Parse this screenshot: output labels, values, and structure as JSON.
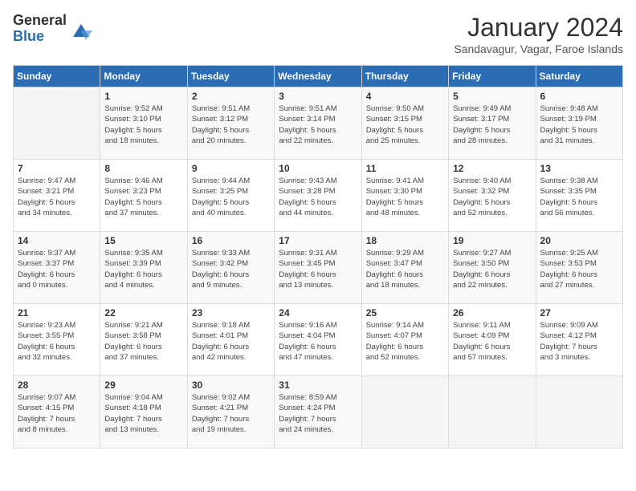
{
  "logo": {
    "general": "General",
    "blue": "Blue"
  },
  "header": {
    "title": "January 2024",
    "location": "Sandavagur, Vagar, Faroe Islands"
  },
  "weekdays": [
    "Sunday",
    "Monday",
    "Tuesday",
    "Wednesday",
    "Thursday",
    "Friday",
    "Saturday"
  ],
  "weeks": [
    [
      {
        "day": "",
        "info": ""
      },
      {
        "day": "1",
        "info": "Sunrise: 9:52 AM\nSunset: 3:10 PM\nDaylight: 5 hours\nand 18 minutes."
      },
      {
        "day": "2",
        "info": "Sunrise: 9:51 AM\nSunset: 3:12 PM\nDaylight: 5 hours\nand 20 minutes."
      },
      {
        "day": "3",
        "info": "Sunrise: 9:51 AM\nSunset: 3:14 PM\nDaylight: 5 hours\nand 22 minutes."
      },
      {
        "day": "4",
        "info": "Sunrise: 9:50 AM\nSunset: 3:15 PM\nDaylight: 5 hours\nand 25 minutes."
      },
      {
        "day": "5",
        "info": "Sunrise: 9:49 AM\nSunset: 3:17 PM\nDaylight: 5 hours\nand 28 minutes."
      },
      {
        "day": "6",
        "info": "Sunrise: 9:48 AM\nSunset: 3:19 PM\nDaylight: 5 hours\nand 31 minutes."
      }
    ],
    [
      {
        "day": "7",
        "info": "Sunrise: 9:47 AM\nSunset: 3:21 PM\nDaylight: 5 hours\nand 34 minutes."
      },
      {
        "day": "8",
        "info": "Sunrise: 9:46 AM\nSunset: 3:23 PM\nDaylight: 5 hours\nand 37 minutes."
      },
      {
        "day": "9",
        "info": "Sunrise: 9:44 AM\nSunset: 3:25 PM\nDaylight: 5 hours\nand 40 minutes."
      },
      {
        "day": "10",
        "info": "Sunrise: 9:43 AM\nSunset: 3:28 PM\nDaylight: 5 hours\nand 44 minutes."
      },
      {
        "day": "11",
        "info": "Sunrise: 9:41 AM\nSunset: 3:30 PM\nDaylight: 5 hours\nand 48 minutes."
      },
      {
        "day": "12",
        "info": "Sunrise: 9:40 AM\nSunset: 3:32 PM\nDaylight: 5 hours\nand 52 minutes."
      },
      {
        "day": "13",
        "info": "Sunrise: 9:38 AM\nSunset: 3:35 PM\nDaylight: 5 hours\nand 56 minutes."
      }
    ],
    [
      {
        "day": "14",
        "info": "Sunrise: 9:37 AM\nSunset: 3:37 PM\nDaylight: 6 hours\nand 0 minutes."
      },
      {
        "day": "15",
        "info": "Sunrise: 9:35 AM\nSunset: 3:39 PM\nDaylight: 6 hours\nand 4 minutes."
      },
      {
        "day": "16",
        "info": "Sunrise: 9:33 AM\nSunset: 3:42 PM\nDaylight: 6 hours\nand 9 minutes."
      },
      {
        "day": "17",
        "info": "Sunrise: 9:31 AM\nSunset: 3:45 PM\nDaylight: 6 hours\nand 13 minutes."
      },
      {
        "day": "18",
        "info": "Sunrise: 9:29 AM\nSunset: 3:47 PM\nDaylight: 6 hours\nand 18 minutes."
      },
      {
        "day": "19",
        "info": "Sunrise: 9:27 AM\nSunset: 3:50 PM\nDaylight: 6 hours\nand 22 minutes."
      },
      {
        "day": "20",
        "info": "Sunrise: 9:25 AM\nSunset: 3:53 PM\nDaylight: 6 hours\nand 27 minutes."
      }
    ],
    [
      {
        "day": "21",
        "info": "Sunrise: 9:23 AM\nSunset: 3:55 PM\nDaylight: 6 hours\nand 32 minutes."
      },
      {
        "day": "22",
        "info": "Sunrise: 9:21 AM\nSunset: 3:58 PM\nDaylight: 6 hours\nand 37 minutes."
      },
      {
        "day": "23",
        "info": "Sunrise: 9:18 AM\nSunset: 4:01 PM\nDaylight: 6 hours\nand 42 minutes."
      },
      {
        "day": "24",
        "info": "Sunrise: 9:16 AM\nSunset: 4:04 PM\nDaylight: 6 hours\nand 47 minutes."
      },
      {
        "day": "25",
        "info": "Sunrise: 9:14 AM\nSunset: 4:07 PM\nDaylight: 6 hours\nand 52 minutes."
      },
      {
        "day": "26",
        "info": "Sunrise: 9:11 AM\nSunset: 4:09 PM\nDaylight: 6 hours\nand 57 minutes."
      },
      {
        "day": "27",
        "info": "Sunrise: 9:09 AM\nSunset: 4:12 PM\nDaylight: 7 hours\nand 3 minutes."
      }
    ],
    [
      {
        "day": "28",
        "info": "Sunrise: 9:07 AM\nSunset: 4:15 PM\nDaylight: 7 hours\nand 8 minutes."
      },
      {
        "day": "29",
        "info": "Sunrise: 9:04 AM\nSunset: 4:18 PM\nDaylight: 7 hours\nand 13 minutes."
      },
      {
        "day": "30",
        "info": "Sunrise: 9:02 AM\nSunset: 4:21 PM\nDaylight: 7 hours\nand 19 minutes."
      },
      {
        "day": "31",
        "info": "Sunrise: 8:59 AM\nSunset: 4:24 PM\nDaylight: 7 hours\nand 24 minutes."
      },
      {
        "day": "",
        "info": ""
      },
      {
        "day": "",
        "info": ""
      },
      {
        "day": "",
        "info": ""
      }
    ]
  ]
}
